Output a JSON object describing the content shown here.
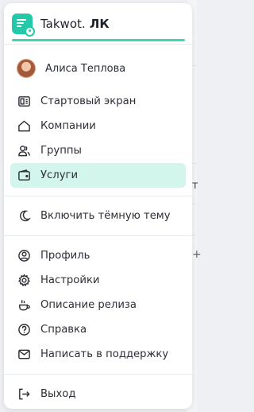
{
  "app": {
    "title_prefix": "Takwot.",
    "title_suffix": " ЛК"
  },
  "user": {
    "name": "Алиса Теплова"
  },
  "nav": {
    "home": "Стартовый экран",
    "companies": "Компании",
    "groups": "Группы",
    "services": "Услуги"
  },
  "theme": {
    "dark_mode": "Включить тёмную тему"
  },
  "account": {
    "profile": "Профиль",
    "settings": "Настройки",
    "release_notes": "Описание релиза",
    "help": "Справка",
    "support": "Написать в поддержку"
  },
  "logout": "Выход",
  "colors": {
    "accent": "#3fd6b8",
    "logo": "#25c8a8",
    "active_bg": "#d2f5ec"
  },
  "background_marks": [
    "т",
    "+"
  ]
}
